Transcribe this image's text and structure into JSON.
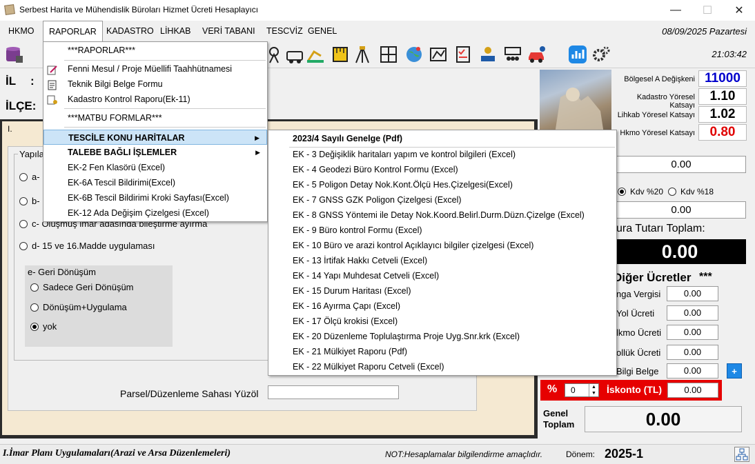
{
  "window": {
    "title": "Serbest Harita ve Mühendislik Büroları Hizmet Ücreti Hesaplayıcı",
    "minimize": "—",
    "maximize": "☐",
    "close": "✕"
  },
  "menubar": {
    "items": [
      "HKMO",
      "RAPORLAR",
      "KADASTRO",
      "LİHKAB",
      "VERİ TABANI",
      "TESCVİZ",
      "GENEL"
    ],
    "active": "RAPORLAR",
    "date": "08/09/2025 Pazartesi"
  },
  "toolbar": {
    "time": "21:03:42"
  },
  "left": {
    "il_label": "İL",
    "il_colon": ":",
    "ilce_label": "İLÇE:",
    "panel_roman": "I.",
    "group_title": "Yapıla",
    "options": [
      "a-",
      "b-",
      "c- Oluşmuş imar adasında bileştirme ayırma",
      "d- 15 ve 16.Madde uygulaması"
    ],
    "geri_donusum_title": "e- Geri Dönüşüm",
    "geri_options": [
      "Sadece Geri Dönüşüm",
      "Dönüşüm+Uygulama",
      "yok"
    ],
    "parsel_label": "Parsel/Düzenleme Sahası Yüzöl"
  },
  "dropdown": {
    "items": [
      {
        "label": "***RAPORLAR***",
        "bold": false
      },
      {
        "label": "Fenni Mesul / Proje Müellifi Taahhütnamesi",
        "bold": false
      },
      {
        "label": "Teknik Bilgi Belge Formu",
        "bold": false
      },
      {
        "label": "Kadastro Kontrol Raporu(Ek-11)",
        "bold": false
      },
      {
        "label": "***MATBU FORMLAR***",
        "bold": false
      },
      {
        "label": "TESCİLE KONU HARİTALAR",
        "bold": true
      },
      {
        "label": "TALEBE BAĞLI İŞLEMLER",
        "bold": true
      },
      {
        "label": "EK-2 Fen Klasörü (Excel)",
        "bold": false
      },
      {
        "label": "EK-6A Tescil Bildirimi(Excel)",
        "bold": false
      },
      {
        "label": "EK-6B Tescil Bildirimi Kroki Sayfası(Excel)",
        "bold": false
      },
      {
        "label": "EK-12 Ada Değişim Çizelgesi (Excel)",
        "bold": false
      }
    ]
  },
  "submenu": {
    "items": [
      "2023/4 Sayılı Genelge (Pdf)",
      "EK - 3 Değişiklik haritaları yapım ve kontrol bilgileri (Excel)",
      "EK - 4 Geodezi Büro Kontrol Formu (Excel)",
      "EK - 5 Poligon Detay Nok.Kont.Ölçü Hes.Çizelgesi(Excel)",
      "EK - 7 GNSS GZK Poligon Çizelgesi (Excel)",
      "EK - 8 GNSS Yöntemi ile Detay Nok.Koord.Belirl.Durm.Düzn.Çizelge (Excel)",
      "EK - 9 Büro kontrol Formu (Excel)",
      "EK - 10 Büro ve arazi kontrol Açıklayıcı bilgiler çizelgesi (Excel)",
      "EK - 13 İrtifak Hakkı Cetveli (Excel)",
      "EK - 14 Yapı Muhdesat Cetveli (Excel)",
      "EK - 15 Durum Haritası (Excel)",
      "EK - 16 Ayırma Çapı (Excel)",
      "EK - 17 Ölçü krokisi (Excel)",
      "EK - 20 Düzenleme Toplulaştırma Proje Uyg.Snr.krk (Excel)",
      "EK - 21 Mülkiyet Raporu (Pdf)",
      "EK - 22 Mülkiyet Raporu Cetveli (Excel)"
    ]
  },
  "right": {
    "katsayilar": [
      {
        "label": "Bölgesel A Değişkeni",
        "value": "11000",
        "color": "#0000cc"
      },
      {
        "label": "Kadastro Yöresel Katsayı",
        "value": "1.10",
        "color": "#000000"
      },
      {
        "label": "Lihkab Yöresel Katsayı",
        "value": "1.02",
        "color": "#000000"
      },
      {
        "label": "Hkmo Yöresel Katsayı",
        "value": "0.80",
        "color": "#e00000"
      }
    ],
    "field1": "0.00",
    "kdv20": "Kdv %20",
    "kdv18": "Kdv %18",
    "field2": "0.00",
    "fatura_label": "ura Tutarı Toplam:",
    "fatura_value": "0.00",
    "diger_title": "Diğer Ücretler",
    "diger_stars": "***",
    "diger_rows": [
      {
        "label": "nga Vergisi",
        "value": "0.00"
      },
      {
        "label": "Yol Ücreti",
        "value": "0.00"
      },
      {
        "label": "lkmo Ücreti",
        "value": "0.00"
      },
      {
        "label": "ollük Ücreti",
        "value": "0.00"
      },
      {
        "label": "Bilgi Belge",
        "value": "0.00"
      }
    ],
    "plus": "+",
    "iskonto_pct": "%",
    "iskonto_num": "0",
    "iskonto_label": "İskonto (TL)",
    "iskonto_value": "0.00",
    "genel_label1": "Genel",
    "genel_label2": "Toplam",
    "genel_value": "0.00"
  },
  "statusbar": {
    "section": "I.İmar Planı Uygulamaları(Arazi ve Arsa Düzenlemeleri)",
    "note": "NOT:Hesaplamalar bilgilendirme amaçlıdır.",
    "donem_label": "Dönem:",
    "donem_value": "2025-1"
  },
  "colors": {
    "accent_red": "#e60000",
    "menu_highlight": "#cce4f7",
    "panel_bg": "#f5e9d2"
  }
}
